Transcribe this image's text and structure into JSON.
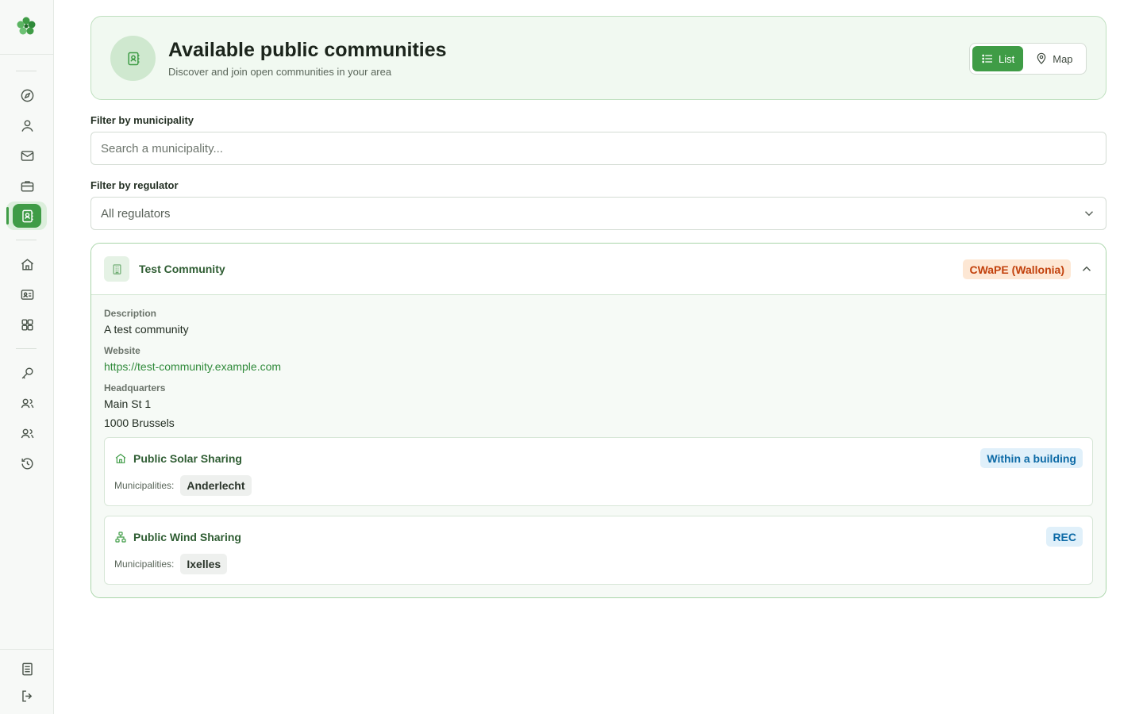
{
  "header": {
    "title": "Available public communities",
    "subtitle": "Discover and join open communities in your area",
    "view_list_label": "List",
    "view_map_label": "Map"
  },
  "filters": {
    "municipality_label": "Filter by municipality",
    "municipality_placeholder": "Search a municipality...",
    "regulator_label": "Filter by regulator",
    "regulator_selected": "All regulators"
  },
  "community": {
    "name": "Test Community",
    "regulator_badge": "CWaPE (Wallonia)",
    "description_label": "Description",
    "description": "A test community",
    "website_label": "Website",
    "website": "https://test-community.example.com",
    "hq_label": "Headquarters",
    "hq_line1": "Main St 1",
    "hq_line2": "1000 Brussels",
    "sharings": [
      {
        "name": "Public Solar Sharing",
        "type": "Within a building",
        "icon": "home-icon",
        "municipalities_label": "Municipalities:",
        "municipality": "Anderlecht"
      },
      {
        "name": "Public Wind Sharing",
        "type": "REC",
        "icon": "network-icon",
        "municipalities_label": "Municipalities:",
        "municipality": "Ixelles"
      }
    ]
  },
  "colors": {
    "accent": "#3f9c46",
    "regulator_badge_bg": "#fde7d4",
    "type_badge_bg": "#e0f0fa"
  }
}
